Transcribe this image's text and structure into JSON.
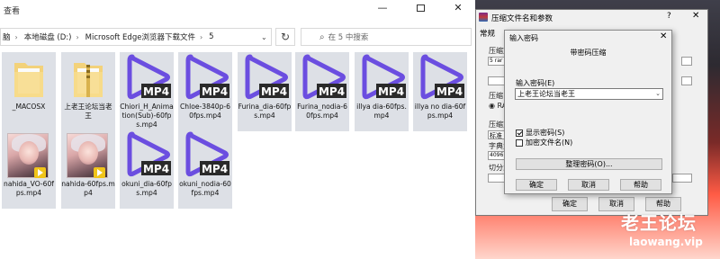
{
  "explorer": {
    "title": "查看",
    "address_crumbs": [
      "脑",
      "本地磁盘 (D:)",
      "Microsoft Edge浏览器下载文件",
      "5"
    ],
    "search_placeholder": "在 5 中搜索",
    "files": [
      {
        "name": "_MACOSX",
        "type": "folder-plain"
      },
      {
        "name": "上老王论坛当老王",
        "type": "folder-zip"
      },
      {
        "name": "Chiori_H_Animation(Sub)-60fps.mp4",
        "type": "mp4"
      },
      {
        "name": "Chloe-3840p-60fps.mp4",
        "type": "mp4"
      },
      {
        "name": "Furina_dia-60fps.mp4",
        "type": "mp4"
      },
      {
        "name": "Furina_nodia-60fps.mp4",
        "type": "mp4"
      },
      {
        "name": "illya dia-60fps.mp4",
        "type": "mp4"
      },
      {
        "name": "illya no dia-60fps.mp4",
        "type": "mp4"
      },
      {
        "name": "nahida_VO-60fps.mp4",
        "type": "image"
      },
      {
        "name": "nahida-60fps.mp4",
        "type": "image"
      },
      {
        "name": "okuni_dia-60fps.mp4",
        "type": "mp4"
      },
      {
        "name": "okuni_nodia-60fps.mp4",
        "type": "mp4"
      }
    ],
    "mp4_badge": "MP4"
  },
  "compress": {
    "title": "压缩文件名和参数",
    "help": "?",
    "close": "✕",
    "tab": "常规",
    "left_labels": [
      "压缩文",
      "5 rar",
      "压缩",
      "RA",
      "压缩方",
      "标准",
      "字典大",
      "4096",
      "切分为"
    ],
    "ok": "确定",
    "cancel": "取消",
    "help_btn": "帮助"
  },
  "password": {
    "title": "输入密码",
    "close": "✕",
    "heading": "带密码压缩",
    "label": "输入密码(E)",
    "value": "上老王论坛当老王",
    "show_password": "显示密码(S)",
    "encrypt_names": "加密文件名(N)",
    "manage": "整理密码(O)...",
    "ok": "确定",
    "cancel": "取消",
    "help": "帮助"
  },
  "watermark": {
    "line1": "老王论坛",
    "line2": "laowang.vip"
  },
  "colors": {
    "mp4_purple": "#6b4ee0",
    "tile_bg": "#dde0e6",
    "folder_yellow": "#f3d27a"
  }
}
